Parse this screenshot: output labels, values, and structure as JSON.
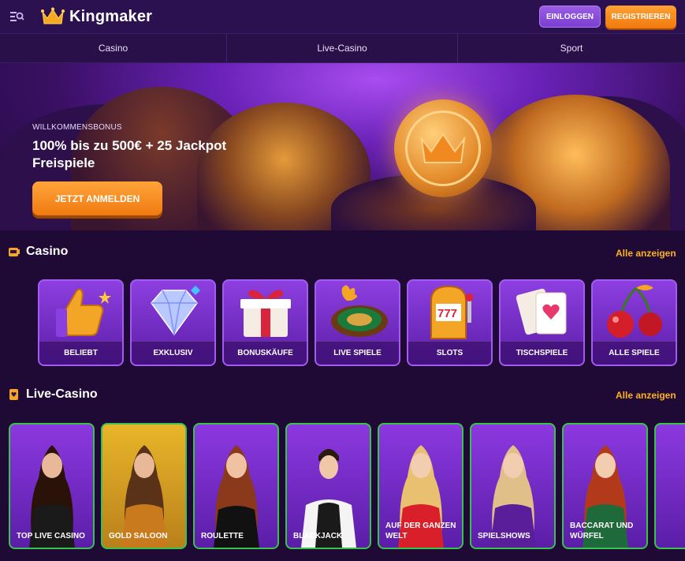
{
  "header": {
    "brand": "Kingmaker",
    "login_label": "EINLOGGEN",
    "register_label": "REGISTRIEREN"
  },
  "nav": {
    "tabs": [
      {
        "label": "Casino"
      },
      {
        "label": "Live-Casino"
      },
      {
        "label": "Sport"
      }
    ]
  },
  "hero": {
    "subtitle": "WILLKOMMENSBONUS",
    "title": "100% bis zu 500€ + 25 Jackpot Freispiele",
    "cta": "JETZT ANMELDEN"
  },
  "casino": {
    "title": "Casino",
    "see_all": "Alle anzeigen",
    "items": [
      {
        "label": "BELIEBT",
        "icon": "thumbs-up-icon"
      },
      {
        "label": "EXKLUSIV",
        "icon": "diamond-icon"
      },
      {
        "label": "BONUSKÄUFE",
        "icon": "gift-icon"
      },
      {
        "label": "LIVE SPIELE",
        "icon": "roulette-icon"
      },
      {
        "label": "SLOTS",
        "icon": "slot-machine-icon"
      },
      {
        "label": "TISCHSPIELE",
        "icon": "cards-icon"
      },
      {
        "label": "ALLE SPIELE",
        "icon": "cherry-icon"
      }
    ]
  },
  "live": {
    "title": "Live-Casino",
    "see_all": "Alle anzeigen",
    "items": [
      {
        "label": "TOP LIVE CASINO"
      },
      {
        "label": "GOLD SALOON"
      },
      {
        "label": "ROULETTE"
      },
      {
        "label": "BLACKJACK"
      },
      {
        "label": "AUF DER GANZEN WELT"
      },
      {
        "label": "SPIELSHOWS"
      },
      {
        "label": "BACCARAT UND WÜRFEL"
      },
      {
        "label": ""
      }
    ]
  },
  "colors": {
    "accent_orange": "#f58a1f",
    "accent_purple": "#8d3fe0",
    "link_yellow": "#ffb21e",
    "live_border_green": "#3ac24f"
  }
}
